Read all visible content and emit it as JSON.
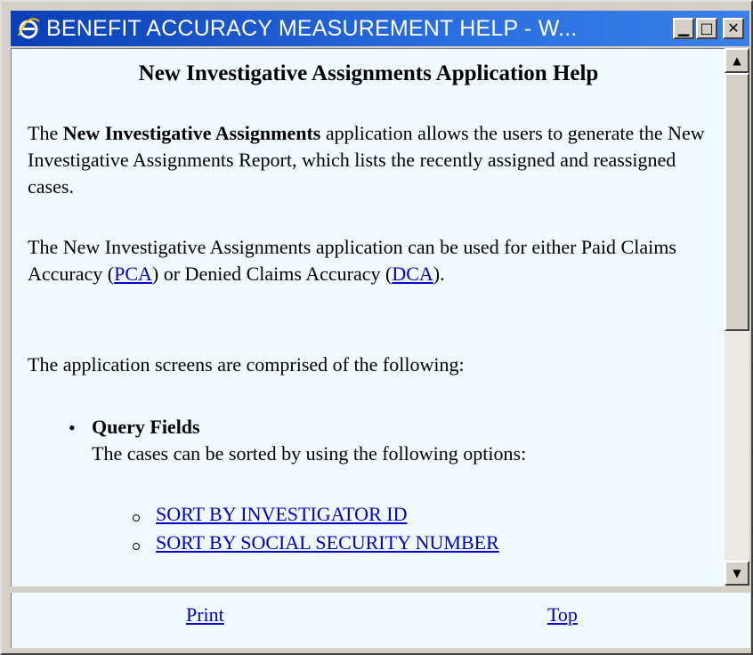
{
  "window": {
    "title": "BENEFIT ACCURACY MEASUREMENT HELP - W...",
    "icon": "ie-browser-icon",
    "controls": {
      "minimize": "▁",
      "maximize": "□",
      "close": "✕"
    }
  },
  "help": {
    "heading": "New Investigative Assignments Application Help",
    "p1": {
      "prefix": "The ",
      "bold": "New Investigative Assignments",
      "suffix": " application allows the users to generate the New Investigative Assignments Report, which lists the recently assigned and reassigned cases."
    },
    "p2": {
      "text_a": "The New Investigative Assignments application can be used for either Paid Claims Accuracy (",
      "link_pca": "PCA",
      "text_b": ") or Denied Claims Accuracy (",
      "link_dca": "DCA",
      "text_c": ")."
    },
    "p3": "The application screens are comprised of the following:",
    "bullet": {
      "title": "Query Fields",
      "description": "The cases can be sorted by using the following options:",
      "options": [
        "SORT BY INVESTIGATOR ID",
        "SORT BY SOCIAL SECURITY NUMBER"
      ]
    }
  },
  "footer": {
    "print": "Print",
    "top": "Top"
  },
  "colors": {
    "titlebar": "#0a3fb5",
    "content_bg": "#f0faff",
    "link": "#0000cc"
  }
}
